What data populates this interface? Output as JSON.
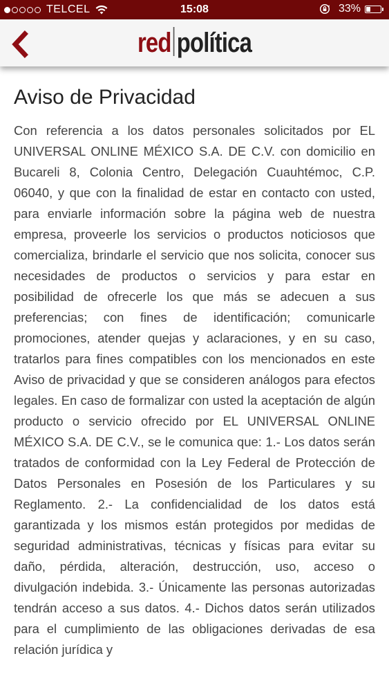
{
  "status_bar": {
    "carrier": "TELCEL",
    "time": "15:08",
    "battery_percent": "33%",
    "battery_level": 0.33,
    "signal_bars_filled": 1,
    "signal_bars_total": 5
  },
  "header": {
    "logo_part1": "red",
    "logo_part2": "política",
    "accent_color": "#8e0e14"
  },
  "page": {
    "title": "Aviso de Privacidad",
    "body": "Con referencia a los datos personales solicitados por EL UNIVERSAL ONLINE MÉXICO S.A. DE C.V. con domicilio en Bucareli 8, Colonia Centro, Delegación Cuauhtémoc, C.P. 06040, y que con la finalidad de estar en contacto con usted, para enviarle información sobre la página web de nuestra empresa, proveerle los servicios o productos noticiosos que comercializa, brindarle el servicio que nos solicita, conocer sus necesidades de productos o servicios y para estar en posibilidad de ofrecerle los que más se adecuen a sus preferencias; con fines de identificación; comunicarle promociones, atender quejas y aclaraciones, y en su caso, tratarlos para fines compatibles con los mencionados en este Aviso de privacidad y que se consideren análogos para efectos legales. En caso de formalizar con usted la aceptación de algún producto o servicio ofrecido por EL UNIVERSAL ONLINE MÉXICO S.A. DE C.V., se le comunica que: 1.- Los datos serán tratados de conformidad con la Ley Federal de Protección de Datos Personales en Posesión de los Particulares y su Reglamento. 2.- La confidencialidad de los datos está garantizada y los mismos están protegidos por medidas de seguridad administrativas, técnicas y físicas para evitar su daño, pérdida, alteración, destrucción, uso, acceso o divulgación indebida. 3.- Únicamente las personas autorizadas tendrán acceso a sus datos. 4.- Dichos datos serán utilizados para el cumplimiento de las obligaciones derivadas de esa relación jurídica y"
  }
}
